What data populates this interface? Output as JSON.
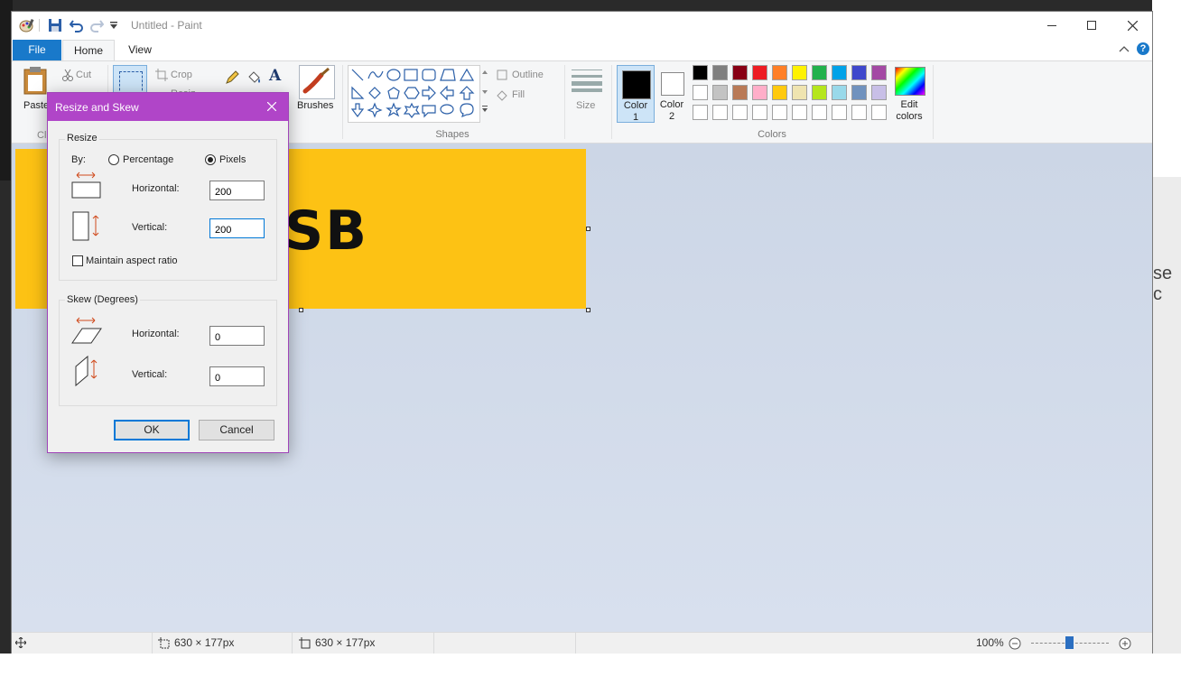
{
  "window": {
    "title": "Untitled - Paint"
  },
  "tabs": {
    "file": "File",
    "home": "Home",
    "view": "View"
  },
  "ribbon": {
    "clipboard": {
      "paste": "Paste",
      "cut": "Cut",
      "group": "Cli"
    },
    "image": {
      "crop": "Crop",
      "resize": "Resiz"
    },
    "brushes": "Brushes",
    "shapes": {
      "outline": "Outline",
      "fill": "Fill",
      "group": "Shapes"
    },
    "size": "Size",
    "color1": [
      "Color",
      "1"
    ],
    "color2": [
      "Color",
      "2"
    ],
    "edit_colors": [
      "Edit",
      "colors"
    ],
    "colors_group": "Colors"
  },
  "palette_row1": [
    "#000000",
    "#7f7f7f",
    "#880015",
    "#ed1c24",
    "#ff7f27",
    "#fff200",
    "#22b14c",
    "#00a2e8",
    "#3f48cc",
    "#a349a4"
  ],
  "palette_row2": [
    "#ffffff",
    "#c3c3c3",
    "#b97a57",
    "#ffaec9",
    "#ffc90e",
    "#efe4b0",
    "#b5e61d",
    "#99d9ea",
    "#7092be",
    "#c8bfe7"
  ],
  "canvas": {
    "image_text": "SB",
    "image_bg": "#fdc214"
  },
  "status": {
    "selection_size": "630 × 177px",
    "image_size": "630 × 177px",
    "zoom": "100%"
  },
  "dialog": {
    "title": "Resize and Skew",
    "resize_label": "Resize",
    "by_label": "By:",
    "percentage": "Percentage",
    "pixels": "Pixels",
    "horizontal_label": "Horizontal:",
    "vertical_label": "Vertical:",
    "resize_h": "200",
    "resize_v": "200",
    "maintain": "Maintain aspect ratio",
    "skew_label": "Skew (Degrees)",
    "skew_h_label": "Horizontal:",
    "skew_v_label": "Vertical:",
    "skew_h": "0",
    "skew_v": "0",
    "ok": "OK",
    "cancel": "Cancel"
  },
  "background": {
    "right_text": "se c"
  }
}
